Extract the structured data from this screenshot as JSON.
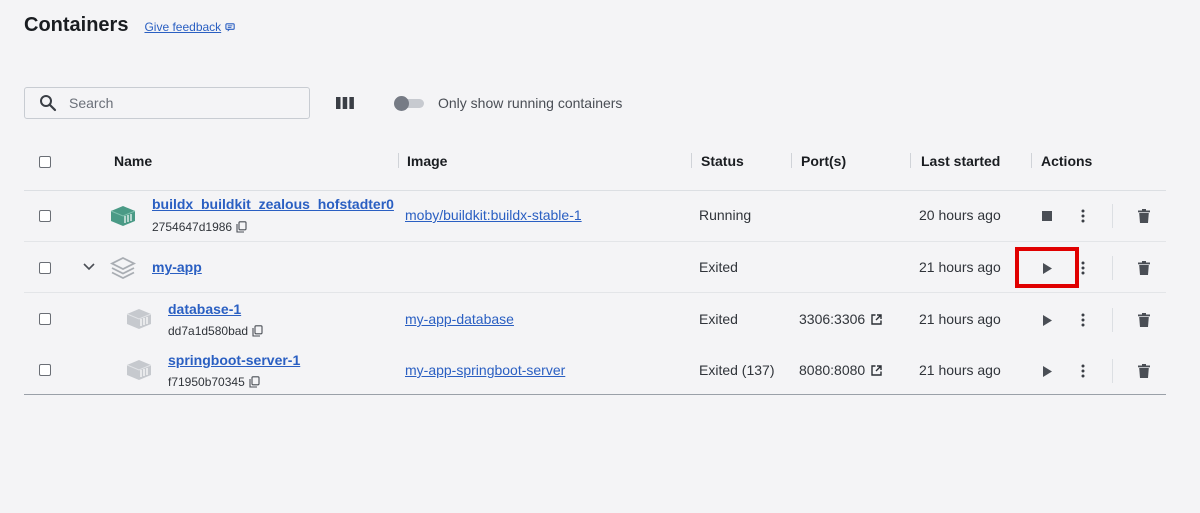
{
  "header": {
    "title": "Containers",
    "feedback": "Give feedback"
  },
  "toolbar": {
    "search_placeholder": "Search",
    "toggle_label": "Only show running containers"
  },
  "columns": {
    "name": "Name",
    "image": "Image",
    "status": "Status",
    "ports": "Port(s)",
    "last_started": "Last started",
    "actions": "Actions"
  },
  "rows": [
    {
      "name": "buildx_buildkit_zealous_hofstadter0",
      "id": "2754647d1986",
      "image": "moby/buildkit:buildx-stable-1",
      "status": "Running",
      "ports": "",
      "last_started": "20 hours ago",
      "icon": "container-icon-green"
    },
    {
      "name": "my-app",
      "id": "",
      "image": "",
      "status": "Exited",
      "ports": "",
      "last_started": "21 hours ago",
      "icon": "stack-icon"
    },
    {
      "name": "database-1",
      "id": "dd7a1d580bad",
      "image": "my-app-database",
      "status": "Exited",
      "ports": "3306:3306",
      "last_started": "21 hours ago",
      "icon": "container-icon-gray"
    },
    {
      "name": "springboot-server-1",
      "id": "f71950b70345",
      "image": "my-app-springboot-server",
      "status": "Exited (137)",
      "ports": "8080:8080",
      "last_started": "21 hours ago",
      "icon": "container-icon-gray"
    }
  ],
  "colors": {
    "link": "#2a5fc2",
    "highlight": "#e00000",
    "running_icon": "#4a9a86",
    "background": "#f4f4f6"
  }
}
